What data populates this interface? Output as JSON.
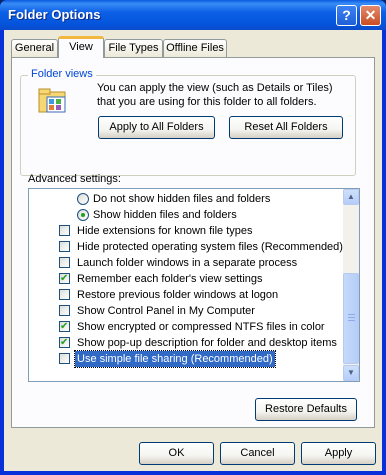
{
  "window": {
    "title": "Folder Options",
    "help_label": "?",
    "close_label": "✕"
  },
  "tabs": [
    {
      "label": "General",
      "active": false
    },
    {
      "label": "View",
      "active": true
    },
    {
      "label": "File Types",
      "active": false
    },
    {
      "label": "Offline Files",
      "active": false
    }
  ],
  "folder_views": {
    "legend": "Folder views",
    "description": "You can apply the view (such as Details or Tiles) that you are using for this folder to all folders.",
    "apply_label": "Apply to All Folders",
    "reset_label": "Reset All Folders",
    "icon": "folder-views-icon"
  },
  "advanced": {
    "label": "Advanced settings:",
    "items": [
      {
        "type": "radio",
        "label": "Do not show hidden files and folders",
        "checked": false
      },
      {
        "type": "radio",
        "label": "Show hidden files and folders",
        "checked": true
      },
      {
        "type": "checkbox",
        "label": "Hide extensions for known file types",
        "checked": false
      },
      {
        "type": "checkbox",
        "label": "Hide protected operating system files (Recommended)",
        "checked": false
      },
      {
        "type": "checkbox",
        "label": "Launch folder windows in a separate process",
        "checked": false
      },
      {
        "type": "checkbox",
        "label": "Remember each folder's view settings",
        "checked": true
      },
      {
        "type": "checkbox",
        "label": "Restore previous folder windows at logon",
        "checked": false
      },
      {
        "type": "checkbox",
        "label": "Show Control Panel in My Computer",
        "checked": false
      },
      {
        "type": "checkbox",
        "label": "Show encrypted or compressed NTFS files in color",
        "checked": true
      },
      {
        "type": "checkbox",
        "label": "Show pop-up description for folder and desktop items",
        "checked": true
      },
      {
        "type": "checkbox",
        "label": "Use simple file sharing (Recommended)",
        "checked": false,
        "selected": true
      }
    ],
    "restore_label": "Restore Defaults"
  },
  "buttons": {
    "ok": "OK",
    "cancel": "Cancel",
    "apply": "Apply"
  },
  "colors": {
    "title_bar": "#0d61e6",
    "selection": "#316ac5",
    "check": "#21a121",
    "dialog": "#ece9d8"
  }
}
